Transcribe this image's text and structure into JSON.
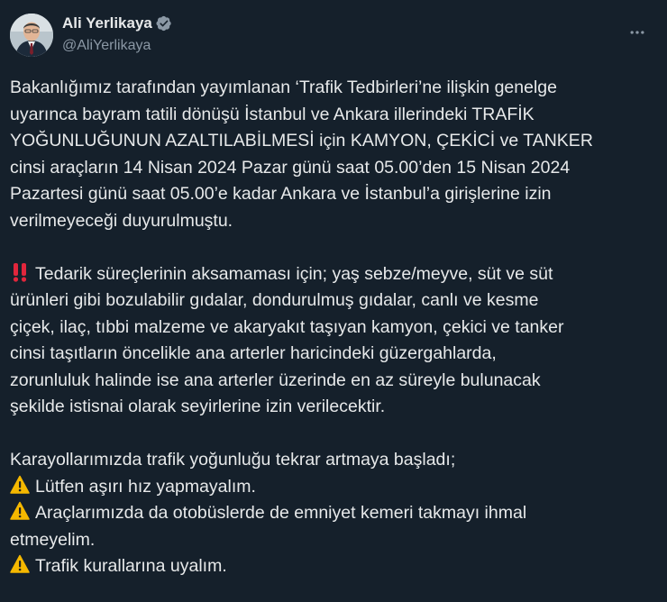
{
  "user": {
    "display_name": "Ali Yerlikaya",
    "handle": "@AliYerlikaya",
    "verified": true
  },
  "icons": {
    "verified": "verified-badge-icon",
    "more": "more-dots-icon",
    "double_exclamation": "double-exclamation-emoji",
    "warning": "warning-emoji"
  },
  "colors": {
    "background": "#15202b",
    "text": "#e7e9ea",
    "secondary_text": "#8b98a5",
    "verified_fill": "#8b98a5",
    "exclamation": "#e2263c",
    "warning": "#f5b800"
  },
  "tweet": {
    "p1": [
      "Bakanlığımız tarafından yayımlanan ‘Trafik Tedbirleri’ne ilişkin genelge",
      "uyarınca bayram tatili dönüşü İstanbul ve Ankara illerindeki TRAFİK",
      "YOĞUNLUĞUNUN AZALTILABİLMESİ için KAMYON, ÇEKİCİ ve TANKER",
      "cinsi araçların 14 Nisan 2024 Pazar günü saat 05.00’den 15 Nisan 2024",
      "Pazartesi günü saat 05.00’e kadar Ankara ve İstanbul’a girişlerine izin",
      "verilmeyeceği duyurulmuştu."
    ],
    "p2": [
      "Tedarik süreçlerinin aksamaması için; yaş sebze/meyve, süt ve süt",
      "ürünleri gibi bozulabilir gıdalar, dondurulmuş gıdalar, canlı ve kesme",
      "çiçek, ilaç, tıbbi malzeme ve akaryakıt taşıyan kamyon, çekici ve tanker",
      "cinsi taşıtların öncelikle ana arterler haricindeki güzergahlarda,",
      "zorunluluk halinde ise ana arterler üzerinde en az süreyle bulunacak",
      "şekilde istisnai olarak seyirlerine izin verilecektir."
    ],
    "p3": [
      "Karayollarımızda trafik yoğunluğu tekrar artmaya başladı;",
      "Lütfen aşırı hız yapmayalım.",
      "Araçlarımızda da otobüslerde de emniyet kemeri takmayı ihmal",
      "etmeyelim.",
      "Trafik kurallarına uyalım."
    ]
  }
}
